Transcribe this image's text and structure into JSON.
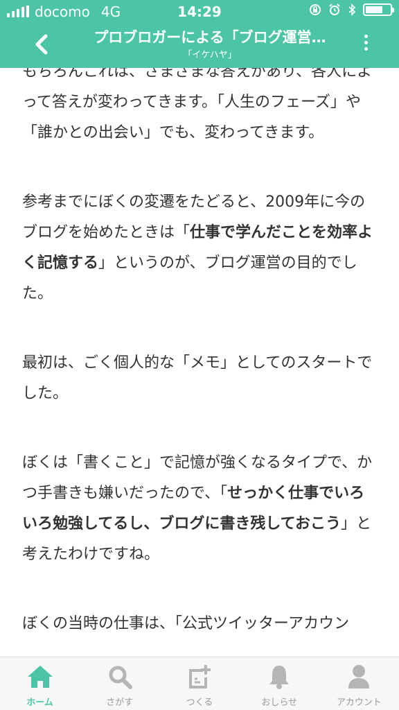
{
  "status": {
    "carrier": "docomo",
    "network": "4G",
    "time": "14:29",
    "battery_level": 0.7
  },
  "header": {
    "title": "プロブロガーによる「ブログ運営…",
    "subtitle": "「イケハヤ」",
    "color": "#4cc5a6"
  },
  "article": {
    "p1": "もちろんこれは、さまざまな答えがあり、各人によって答えが変わってきます。「人生のフェーズ」や「誰かとの出会い」でも、変わってきます。",
    "p2_a": "参考までにぼくの変遷をたどると、2009年に今のブログを始めたときは「",
    "p2_b": "仕事で学んだことを効率よく記憶する",
    "p2_c": "」というのが、ブログ運営の目的でした。",
    "p3": "最初は、ごく個人的な「メモ」としてのスタートでした。",
    "p4_a": "ぼくは「書くこと」で記憶が強くなるタイプで、かつ手書きも嫌いだったので、「",
    "p4_b": "せっかく仕事でいろいろ勉強してるし、ブログに書き残しておこう",
    "p4_c": "」と考えたわけですね。",
    "p5": "ぼくの当時の仕事は、「公式ツイッターアカウン"
  },
  "tabs": [
    {
      "label": "ホーム",
      "icon": "home-icon",
      "active": true
    },
    {
      "label": "さがす",
      "icon": "search-icon",
      "active": false
    },
    {
      "label": "つくる",
      "icon": "compose-icon",
      "active": false
    },
    {
      "label": "おしらせ",
      "icon": "bell-icon",
      "active": false
    },
    {
      "label": "アカウント",
      "icon": "person-icon",
      "active": false
    }
  ],
  "colors": {
    "accent": "#4cc5a6",
    "inactive_icon": "#b5b5b5",
    "text": "#333333"
  }
}
